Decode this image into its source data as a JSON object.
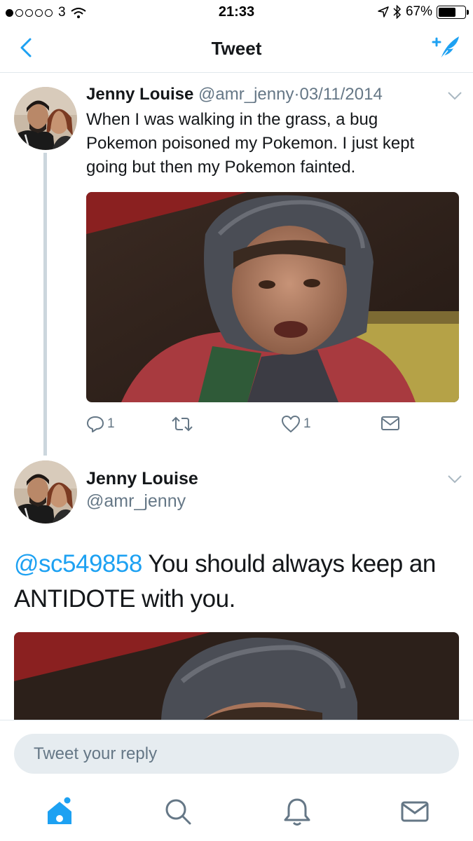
{
  "status_bar": {
    "signal_dots": 5,
    "signal_active": 1,
    "carrier": "3",
    "time": "21:33",
    "battery_percent": "67%",
    "battery_level": 0.67,
    "icons": [
      "wifi-icon",
      "location-arrow-icon",
      "bluetooth-icon",
      "battery-icon"
    ]
  },
  "nav": {
    "title": "Tweet",
    "back_icon": "chevron-left-icon",
    "compose_icon": "compose-tweet-icon",
    "accent_color": "#1da1f2"
  },
  "tweet1": {
    "name": "Jenny Louise",
    "handle": "@amr_jenny",
    "separator": "·",
    "date": "03/11/2014",
    "text": "When I was walking in the grass, a bug Pokemon poisoned my Pokemon. I just kept going but then my Pokemon fainted.",
    "media": "photo of crying child in hooded raincoat",
    "actions": {
      "reply_count": "1",
      "retweet_count": "",
      "like_count": "1"
    }
  },
  "tweet2": {
    "name": "Jenny Louise",
    "handle": "@amr_jenny",
    "mention": "@sc549858",
    "text": " You should always keep an ANTIDOTE with you.",
    "media": "photo of crying child in hooded raincoat (cropped)"
  },
  "reply": {
    "placeholder": "Tweet your reply"
  },
  "tabs": [
    {
      "name": "home",
      "icon": "home-icon",
      "active": true
    },
    {
      "name": "search",
      "icon": "search-icon",
      "active": false
    },
    {
      "name": "notifications",
      "icon": "bell-icon",
      "active": false
    },
    {
      "name": "messages",
      "icon": "envelope-icon",
      "active": false
    }
  ]
}
